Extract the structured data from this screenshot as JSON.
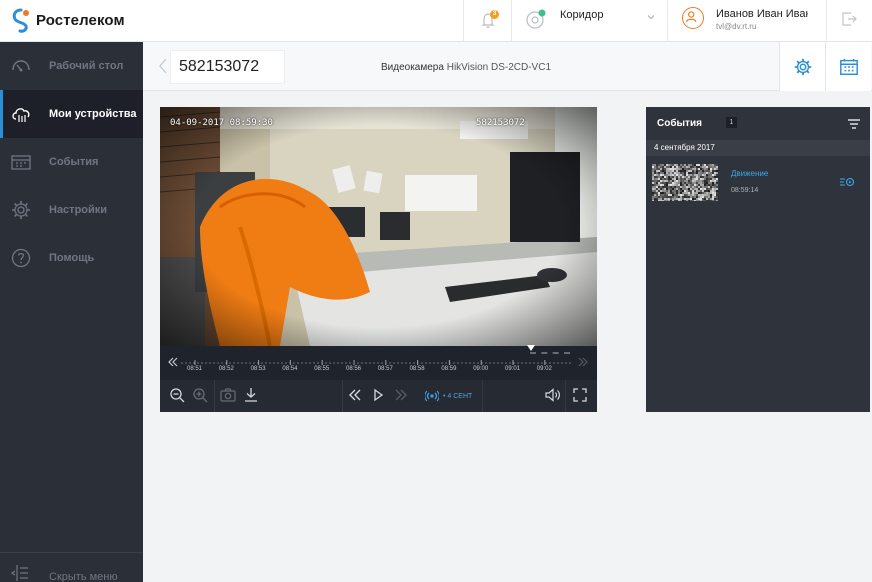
{
  "header": {
    "brand": "Ростелеком",
    "notifications_count": "3",
    "location": "Коридор",
    "user_name": "Иванов Иван Иванович",
    "user_email": "tvl@dv.rt.ru"
  },
  "sidebar": {
    "items": [
      {
        "label": "Рабочий стол"
      },
      {
        "label": "Мои устройства"
      },
      {
        "label": "События"
      },
      {
        "label": "Настройки"
      },
      {
        "label": "Помощь"
      }
    ],
    "hide_label": "Скрыть меню"
  },
  "device": {
    "id": "582153072",
    "type_label": "Видеокамера",
    "model": "HikVision DS-2CD-VC1"
  },
  "video": {
    "osd_datetime": "04-09-2017 08:59:30",
    "osd_id": "582153072"
  },
  "timeline": {
    "ticks": [
      "08:51",
      "08:52",
      "08:53",
      "08:54",
      "08:55",
      "08:56",
      "08:57",
      "08:58",
      "08:59",
      "09:00",
      "09:01",
      "09:02"
    ]
  },
  "controls": {
    "live_label": "• 4 СЕНТ"
  },
  "events": {
    "title": "События",
    "count": "1",
    "date_header": "4 сентября 2017",
    "items": [
      {
        "name": "Движение",
        "time": "08:59:14"
      }
    ]
  },
  "colors": {
    "accent": "#2a8fd6",
    "sidebar_bg": "#2b2f38",
    "orange": "#f07a20"
  }
}
